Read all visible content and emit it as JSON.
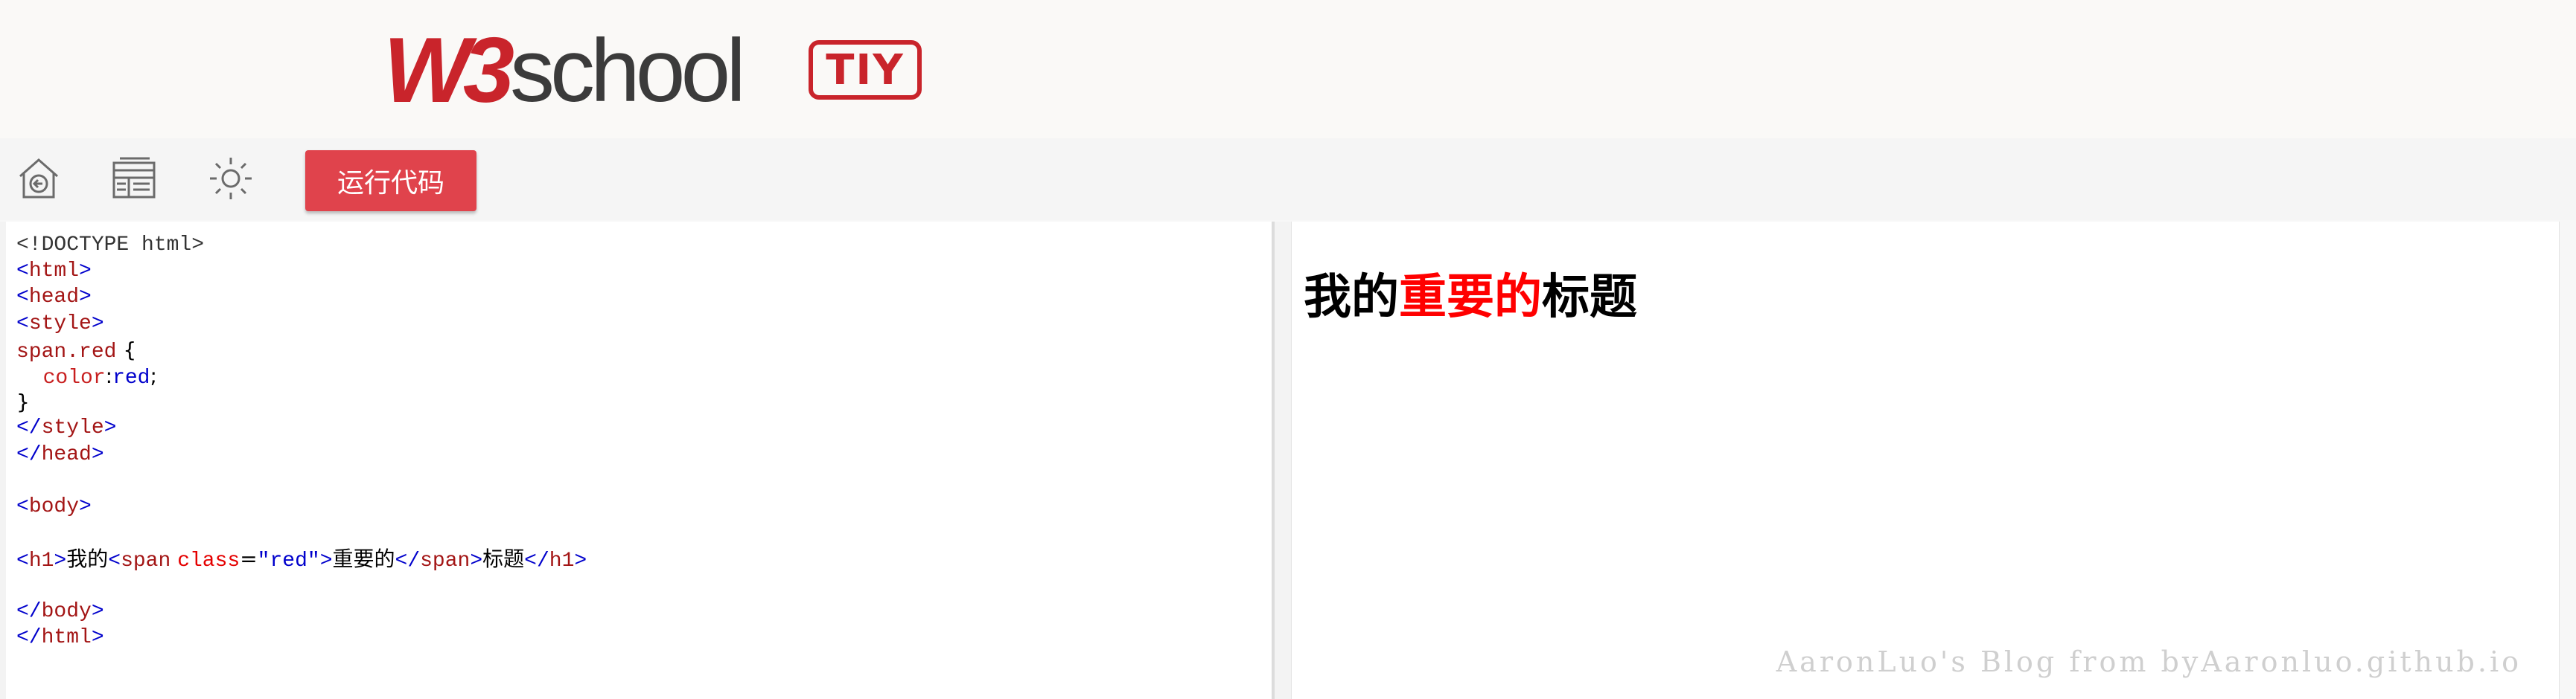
{
  "header": {
    "logo_w3": "W3",
    "logo_school": "school",
    "badge": "TIY"
  },
  "toolbar": {
    "icons": [
      "home-back-icon",
      "layout-icon",
      "sun-icon"
    ],
    "run_label": "运行代码",
    "run_color": "#e0434c"
  },
  "editor": {
    "lines": [
      [
        {
          "c": "doc",
          "t": "<!DOCTYPE html>"
        }
      ],
      [
        {
          "c": "tag",
          "t": "<"
        },
        {
          "c": "tn",
          "t": "html"
        },
        {
          "c": "tag",
          "t": ">"
        }
      ],
      [
        {
          "c": "tag",
          "t": "<"
        },
        {
          "c": "tn",
          "t": "head"
        },
        {
          "c": "tag",
          "t": ">"
        }
      ],
      [
        {
          "c": "tag",
          "t": "<"
        },
        {
          "c": "tn",
          "t": "style"
        },
        {
          "c": "tag",
          "t": ">"
        }
      ],
      [
        {
          "c": "sel",
          "t": "span.red"
        },
        {
          "c": "txt",
          "t": " {"
        }
      ],
      [
        {
          "c": "txt",
          "t": "    "
        },
        {
          "c": "prop",
          "t": "color"
        },
        {
          "c": "txt",
          "t": ":"
        },
        {
          "c": "val",
          "t": "red"
        },
        {
          "c": "txt",
          "t": ";"
        }
      ],
      [
        {
          "c": "txt",
          "t": "}"
        }
      ],
      [
        {
          "c": "tag",
          "t": "</"
        },
        {
          "c": "tn",
          "t": "style"
        },
        {
          "c": "tag",
          "t": ">"
        }
      ],
      [
        {
          "c": "tag",
          "t": "</"
        },
        {
          "c": "tn",
          "t": "head"
        },
        {
          "c": "tag",
          "t": ">"
        }
      ],
      [],
      [
        {
          "c": "tag",
          "t": "<"
        },
        {
          "c": "tn",
          "t": "body"
        },
        {
          "c": "tag",
          "t": ">"
        }
      ],
      [],
      [
        {
          "c": "tag",
          "t": "<"
        },
        {
          "c": "tn",
          "t": "h1"
        },
        {
          "c": "tag",
          "t": ">"
        },
        {
          "c": "txt",
          "t": "我的"
        },
        {
          "c": "tag",
          "t": "<"
        },
        {
          "c": "tn",
          "t": "span"
        },
        {
          "c": "txt",
          "t": " "
        },
        {
          "c": "attr",
          "t": "class"
        },
        {
          "c": "txt",
          "t": "="
        },
        {
          "c": "str",
          "t": "\"red\""
        },
        {
          "c": "tag",
          "t": ">"
        },
        {
          "c": "txt",
          "t": "重要的"
        },
        {
          "c": "tag",
          "t": "</"
        },
        {
          "c": "tn",
          "t": "span"
        },
        {
          "c": "tag",
          "t": ">"
        },
        {
          "c": "txt",
          "t": "标题"
        },
        {
          "c": "tag",
          "t": "</"
        },
        {
          "c": "tn",
          "t": "h1"
        },
        {
          "c": "tag",
          "t": ">"
        }
      ],
      [],
      [
        {
          "c": "tag",
          "t": "</"
        },
        {
          "c": "tn",
          "t": "body"
        },
        {
          "c": "tag",
          "t": ">"
        }
      ],
      [
        {
          "c": "tag",
          "t": "</"
        },
        {
          "c": "tn",
          "t": "html"
        },
        {
          "c": "tag",
          "t": ">"
        }
      ]
    ]
  },
  "preview": {
    "h1_before": "我的",
    "h1_red": "重要的",
    "h1_after": "标题",
    "red_color": "#ff0000"
  },
  "watermark": "AaronLuo's Blog from byAaronluo.github.io"
}
